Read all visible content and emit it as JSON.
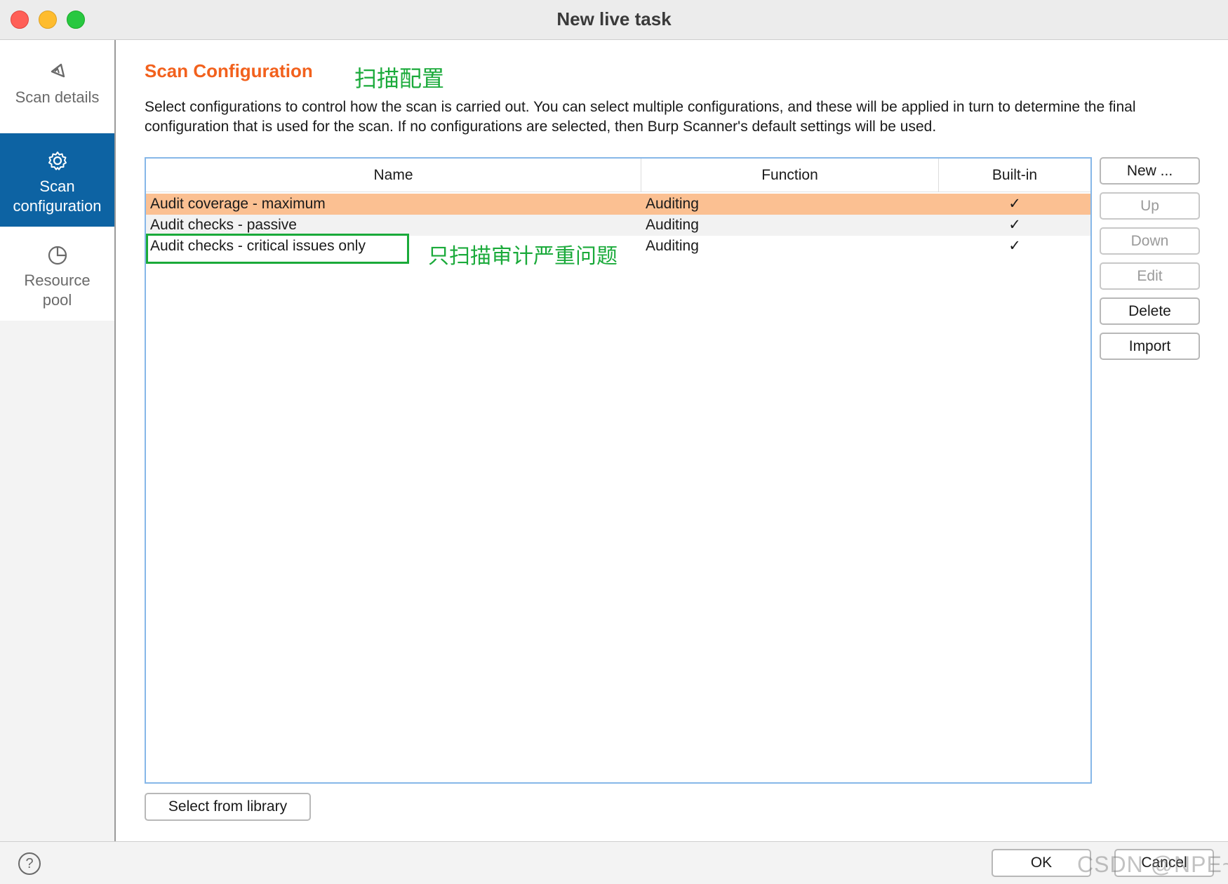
{
  "window": {
    "title": "New live task"
  },
  "sidebar": {
    "items": [
      {
        "label": "Scan details",
        "icon": "scan-details-icon",
        "active": false
      },
      {
        "label": "Scan\nconfiguration",
        "icon": "gear-icon",
        "active": true
      },
      {
        "label": "Resource\npool",
        "icon": "pie-chart-icon",
        "active": false
      }
    ]
  },
  "main": {
    "section_title": "Scan Configuration",
    "title_annotation": "扫描配置",
    "description": "Select configurations to control how the scan is carried out. You can select multiple configurations, and these will be applied in turn to determine the final configuration that is used for the scan. If no configurations are selected, then Burp Scanner's default settings will be used.",
    "table": {
      "columns": [
        "Name",
        "Function",
        "Built-in"
      ],
      "rows": [
        {
          "name": "Audit coverage - maximum",
          "function": "Auditing",
          "builtin": "✓"
        },
        {
          "name": "Audit checks - passive",
          "function": "Auditing",
          "builtin": "✓"
        },
        {
          "name": "Audit checks - critical issues only",
          "function": "Auditing",
          "builtin": "✓"
        }
      ],
      "row_annotation": "只扫描审计严重问题"
    },
    "buttons": {
      "new": "New ...",
      "up": "Up",
      "down": "Down",
      "edit": "Edit",
      "delete": "Delete",
      "import": "Import",
      "select_library": "Select from library"
    }
  },
  "footer": {
    "help": "?",
    "ok": "OK",
    "cancel": "Cancel",
    "watermark": "CSDN @NPE~"
  },
  "colors": {
    "accent": "#f2611d",
    "sidebar_active": "#0d63a3",
    "selected_row": "#fbc092",
    "annotation_green": "#1aaa3a",
    "table_border": "#86b7e8"
  }
}
